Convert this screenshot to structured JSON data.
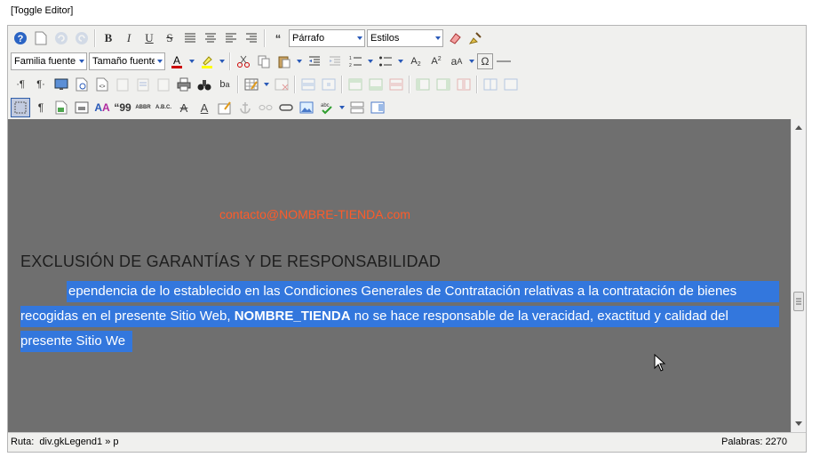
{
  "toggle_label": "[Toggle Editor]",
  "toolbar1": {
    "format_select": "Párrafo",
    "styles_select": "Estilos"
  },
  "toolbar2": {
    "font_family": "Familia fuente",
    "font_size": "Tamaño fuente"
  },
  "content": {
    "email": "contacto@NOMBRE-TIENDA.com",
    "heading": "EXCLUSIÓN DE GARANTÍAS Y DE RESPONSABILIDAD",
    "line1": "ependencia de lo establecido en las Condiciones Generales de Contratación relativas a la contratación de bienes",
    "line2a": "recogidas en el presente Sitio Web, ",
    "line2b": "NOMBRE_TIENDA",
    "line2c": " no se hace responsable de la veracidad, exactitud y calidad del",
    "line3": "presente Sitio We"
  },
  "statusbar": {
    "path_label": "Ruta:",
    "path_value": "div.gkLegend1 » p",
    "words": "Palabras: 2270"
  },
  "colors": {
    "editor_bg": "#6f6f6f",
    "selection": "#3377dd",
    "email": "#ff5b29"
  }
}
